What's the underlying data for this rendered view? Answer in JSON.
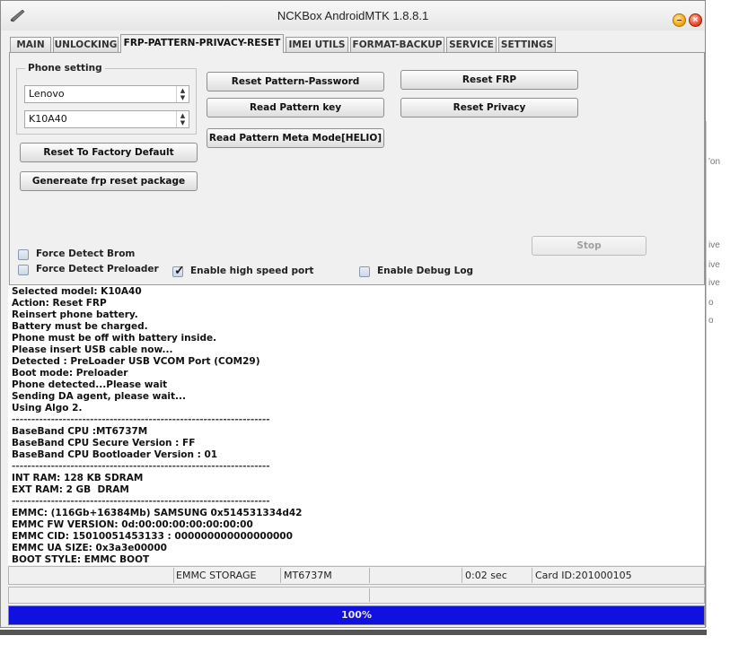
{
  "window": {
    "title": "NCKBox AndroidMTK 1.8.8.1"
  },
  "tabs": [
    {
      "label": "MAIN"
    },
    {
      "label": "UNLOCKING"
    },
    {
      "label": "FRP-PATTERN-PRIVACY-RESET",
      "active": true
    },
    {
      "label": "IMEI UTILS"
    },
    {
      "label": "FORMAT-BACKUP"
    },
    {
      "label": "SERVICE"
    },
    {
      "label": "SETTINGS"
    }
  ],
  "phone_setting": {
    "title": "Phone setting",
    "brand": "Lenovo",
    "model": "K10A40"
  },
  "buttons": {
    "reset_factory": "Reset To Factory Default",
    "generate_frp": "Genereate frp reset package",
    "reset_pattern_password": "Reset Pattern-Password",
    "read_pattern_key": "Read Pattern key",
    "read_pattern_meta": "Read Pattern Meta Mode[HELIO]",
    "reset_frp": "Reset FRP",
    "reset_privacy": "Reset Privacy",
    "stop": "Stop"
  },
  "options": {
    "force_detect_brom": {
      "label": "Force Detect Brom",
      "checked": false
    },
    "force_detect_preloader": {
      "label": "Force Detect Preloader",
      "checked": false
    },
    "high_speed_port": {
      "label": "Enable high speed port",
      "checked": true
    },
    "debug_log": {
      "label": "Enable Debug Log",
      "checked": false
    }
  },
  "log": [
    "Selected model: K10A40",
    "Action: Reset FRP",
    "Reinsert phone battery.",
    "Battery must be charged.",
    "Phone must be off with battery inside.",
    "Please insert USB cable now...",
    "Detected : PreLoader USB VCOM Port (COM29)",
    "Boot mode: Preloader",
    "Phone detected...Please wait",
    "Sending DA agent, please wait...",
    "Using Algo 2.",
    "------------------------------------------------------------------",
    "BaseBand CPU :MT6737M",
    "BaseBand CPU Secure Version : FF",
    "BaseBand CPU Bootloader Version : 01",
    "------------------------------------------------------------------",
    "INT RAM: 128 KB SDRAM",
    "EXT RAM: 2 GB  DRAM",
    "------------------------------------------------------------------",
    "EMMC: (116Gb+16384Mb) SAMSUNG 0x514531334d42",
    "EMMC FW VERSION: 0d:00:00:00:00:00:00:00",
    "EMMC CID: 15010051453133 : 000000000000000000",
    "EMMC UA SIZE: 0x3a3e00000",
    "BOOT STYLE: EMMC BOOT"
  ],
  "status": {
    "storage": "EMMC STORAGE",
    "cpu": "MT6737M",
    "time": "0:02 sec",
    "card_id": "Card ID:201000105"
  },
  "progress": {
    "percent": 100,
    "label": "100%"
  },
  "background_fragments": [
    "'on",
    "ive",
    "ive",
    "ive",
    "o",
    "o"
  ],
  "colors": {
    "progress": "#1010e0"
  }
}
